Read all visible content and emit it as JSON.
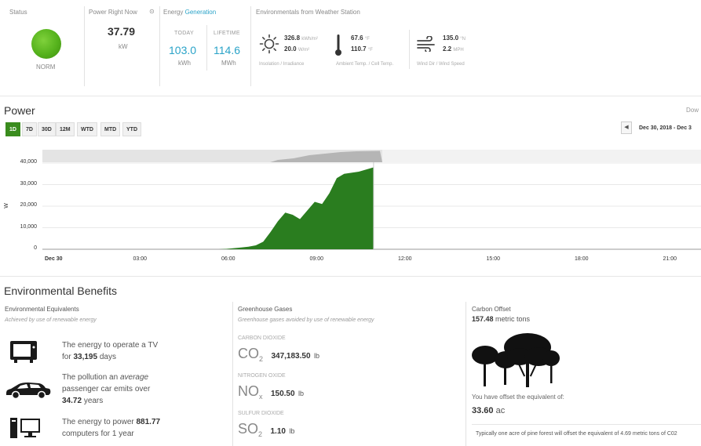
{
  "top": {
    "status": {
      "label": "Status",
      "state": "NORM",
      "color": "#55b21c"
    },
    "power_now": {
      "label": "Power Right Now",
      "value": "37.79",
      "unit": "kW"
    },
    "energy": {
      "label": "Energy",
      "label_accent": "Generation",
      "today_label": "TODAY",
      "today_value": "103.0",
      "today_unit": "kWh",
      "lifetime_label": "LIFETIME",
      "lifetime_value": "114.6",
      "lifetime_unit": "MWh"
    },
    "weather": {
      "label": "Environmentals from Weather Station",
      "insolation": "326.8",
      "insolation_unit": "kWh/m²",
      "irradiance": "20.0",
      "irradiance_unit": "W/m²",
      "insolation_caption": "Insolation / Irradiance",
      "ambient_temp": "67.6",
      "ambient_unit": "°F",
      "cell_temp": "110.7",
      "cell_unit": "°F",
      "temp_caption": "Ambient Temp. / Cell Temp.",
      "wind_dir": "135.0",
      "wind_dir_unit": "°N",
      "wind_speed": "2.2",
      "wind_speed_unit": "MPH",
      "wind_caption": "Wind Dir / Wind Speed"
    }
  },
  "power": {
    "title": "Power",
    "download_label": "Dow",
    "ranges": [
      {
        "label": "1D",
        "active": true
      },
      {
        "label": "7D",
        "active": false
      },
      {
        "label": "30D",
        "active": false
      },
      {
        "label": "12M",
        "active": false
      },
      {
        "label": "WTD",
        "active": false
      },
      {
        "label": "MTD",
        "active": false
      },
      {
        "label": "YTD",
        "active": false
      }
    ],
    "prev_label": "◀",
    "date_range": "Dec 30, 2018 - Dec 3"
  },
  "chart_data": {
    "type": "area",
    "ylabel": "W",
    "ylim": [
      0,
      40000
    ],
    "y_ticks": [
      "40,000",
      "30,000",
      "20,000",
      "10,000",
      "0"
    ],
    "x_ticks": [
      "Dec 30",
      "03:00",
      "06:00",
      "09:00",
      "12:00",
      "15:00",
      "18:00",
      "21:00"
    ],
    "x_hours": [
      0,
      0.25,
      0.5,
      0.75,
      1,
      1.25,
      1.5,
      1.75,
      2,
      2.25,
      2.5,
      2.75,
      3,
      3.25,
      3.5,
      3.75,
      4,
      4.25,
      4.5,
      4.75,
      5,
      5.25,
      5.5,
      5.75,
      6,
      6.25,
      6.5,
      6.75,
      7,
      7.25,
      7.5,
      7.75,
      8,
      8.25,
      8.5,
      8.75,
      9,
      9.25,
      9.5,
      9.75,
      10,
      10.25,
      10.5,
      10.75,
      11,
      11.25
    ],
    "values": [
      0,
      0,
      0,
      0,
      0,
      0,
      0,
      0,
      0,
      0,
      0,
      0,
      0,
      0,
      0,
      0,
      0,
      0,
      0,
      0,
      0,
      0,
      0,
      0,
      0,
      200,
      500,
      800,
      1200,
      1800,
      3500,
      8000,
      13000,
      17000,
      16000,
      14000,
      18000,
      22000,
      21000,
      26000,
      33000,
      35000,
      35500,
      36000,
      37000,
      38000,
      38500
    ],
    "color": "#2a7d1f"
  },
  "benefits": {
    "title": "Environmental Benefits",
    "equivalents": {
      "title": "Environmental Equivalents",
      "desc": "Achieved by use of renewable energy",
      "tv_pre": "The energy to operate a TV",
      "tv_for": "for",
      "tv_days": "33,195",
      "tv_unit": "days",
      "car_pre": "The pollution an",
      "car_italic": "average",
      "car_mid": "passenger car emits over",
      "car_years": "34.72",
      "car_unit": "years",
      "pc_pre": "The energy to power",
      "pc_num": "881.77",
      "pc_post": "computers for 1 year"
    },
    "ghg": {
      "title": "Greenhouse Gases",
      "desc": "Greenhouse gases avoided by use of renewable energy",
      "co2_name": "CARBON DIOXIDE",
      "co2_formula": "CO",
      "co2_sub": "2",
      "co2_val": "347,183.50",
      "co2_unit": "lb",
      "nox_name": "NITROGEN OXIDE",
      "nox_formula": "NO",
      "nox_sub": "x",
      "nox_val": "150.50",
      "nox_unit": "lb",
      "so2_name": "SULFUR DIOXIDE",
      "so2_formula": "SO",
      "so2_sub": "2",
      "so2_val": "1.10",
      "so2_unit": "lb"
    },
    "carbon": {
      "title": "Carbon Offset",
      "value": "157.48",
      "unit": "metric tons",
      "equiv_text": "You have offset the equivalent of:",
      "acres": "33.60",
      "acres_unit": "ac",
      "note": "Typically one acre of pine forest will offset the equivalent of 4.69 metric tons of C02"
    }
  }
}
